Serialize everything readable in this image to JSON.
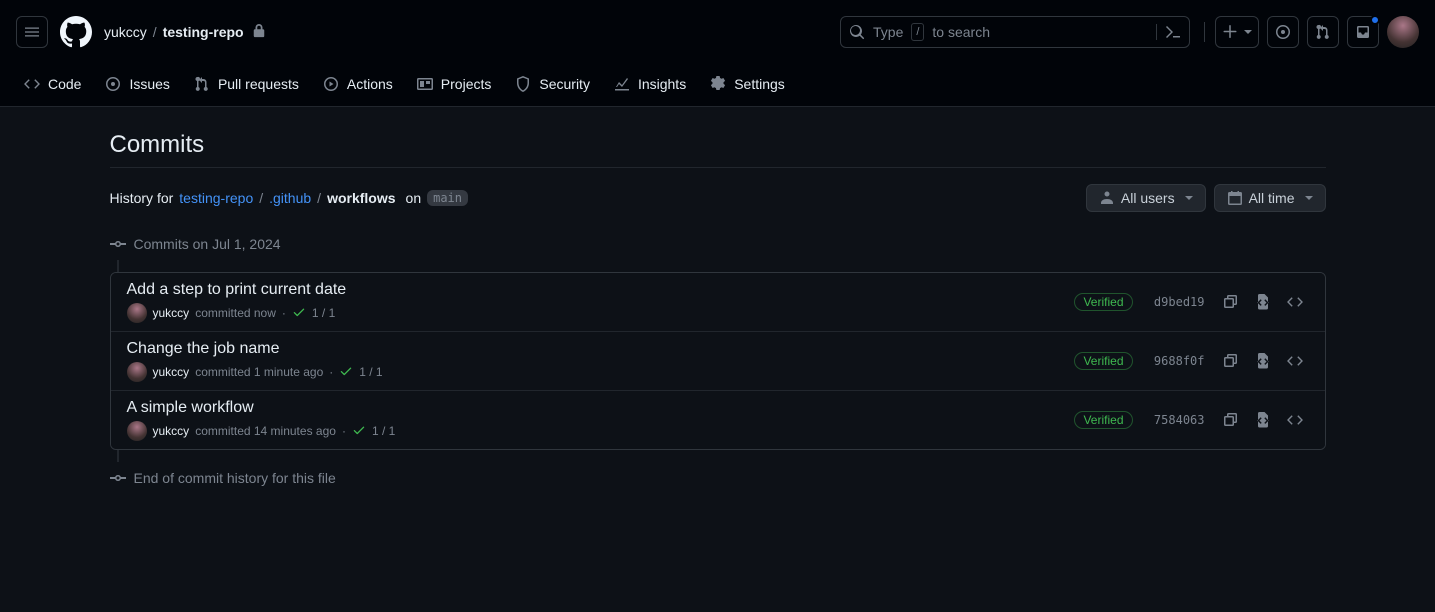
{
  "header": {
    "owner": "yukccy",
    "repo": "testing-repo",
    "search_placeholder_pre": "Type",
    "search_key": "/",
    "search_placeholder_post": "to search"
  },
  "nav": {
    "code": "Code",
    "issues": "Issues",
    "pull_requests": "Pull requests",
    "actions": "Actions",
    "projects": "Projects",
    "security": "Security",
    "insights": "Insights",
    "settings": "Settings"
  },
  "page": {
    "title": "Commits",
    "history_prefix": "History for",
    "path_repo": "testing-repo",
    "path_github": ".github",
    "path_workflows": "workflows",
    "on": "on",
    "branch": "main",
    "filter_users": "All users",
    "filter_time": "All time"
  },
  "timeline": {
    "group_label": "Commits on Jul 1, 2024",
    "end_label": "End of commit history for this file"
  },
  "commits": [
    {
      "title": "Add a step to print current date",
      "author": "yukccy",
      "committed_text": "committed now",
      "checks": "1 / 1",
      "verified": "Verified",
      "sha": "d9bed19"
    },
    {
      "title": "Change the job name",
      "author": "yukccy",
      "committed_text": "committed 1 minute ago",
      "checks": "1 / 1",
      "verified": "Verified",
      "sha": "9688f0f"
    },
    {
      "title": "A simple workflow",
      "author": "yukccy",
      "committed_text": "committed 14 minutes ago",
      "checks": "1 / 1",
      "verified": "Verified",
      "sha": "7584063"
    }
  ]
}
